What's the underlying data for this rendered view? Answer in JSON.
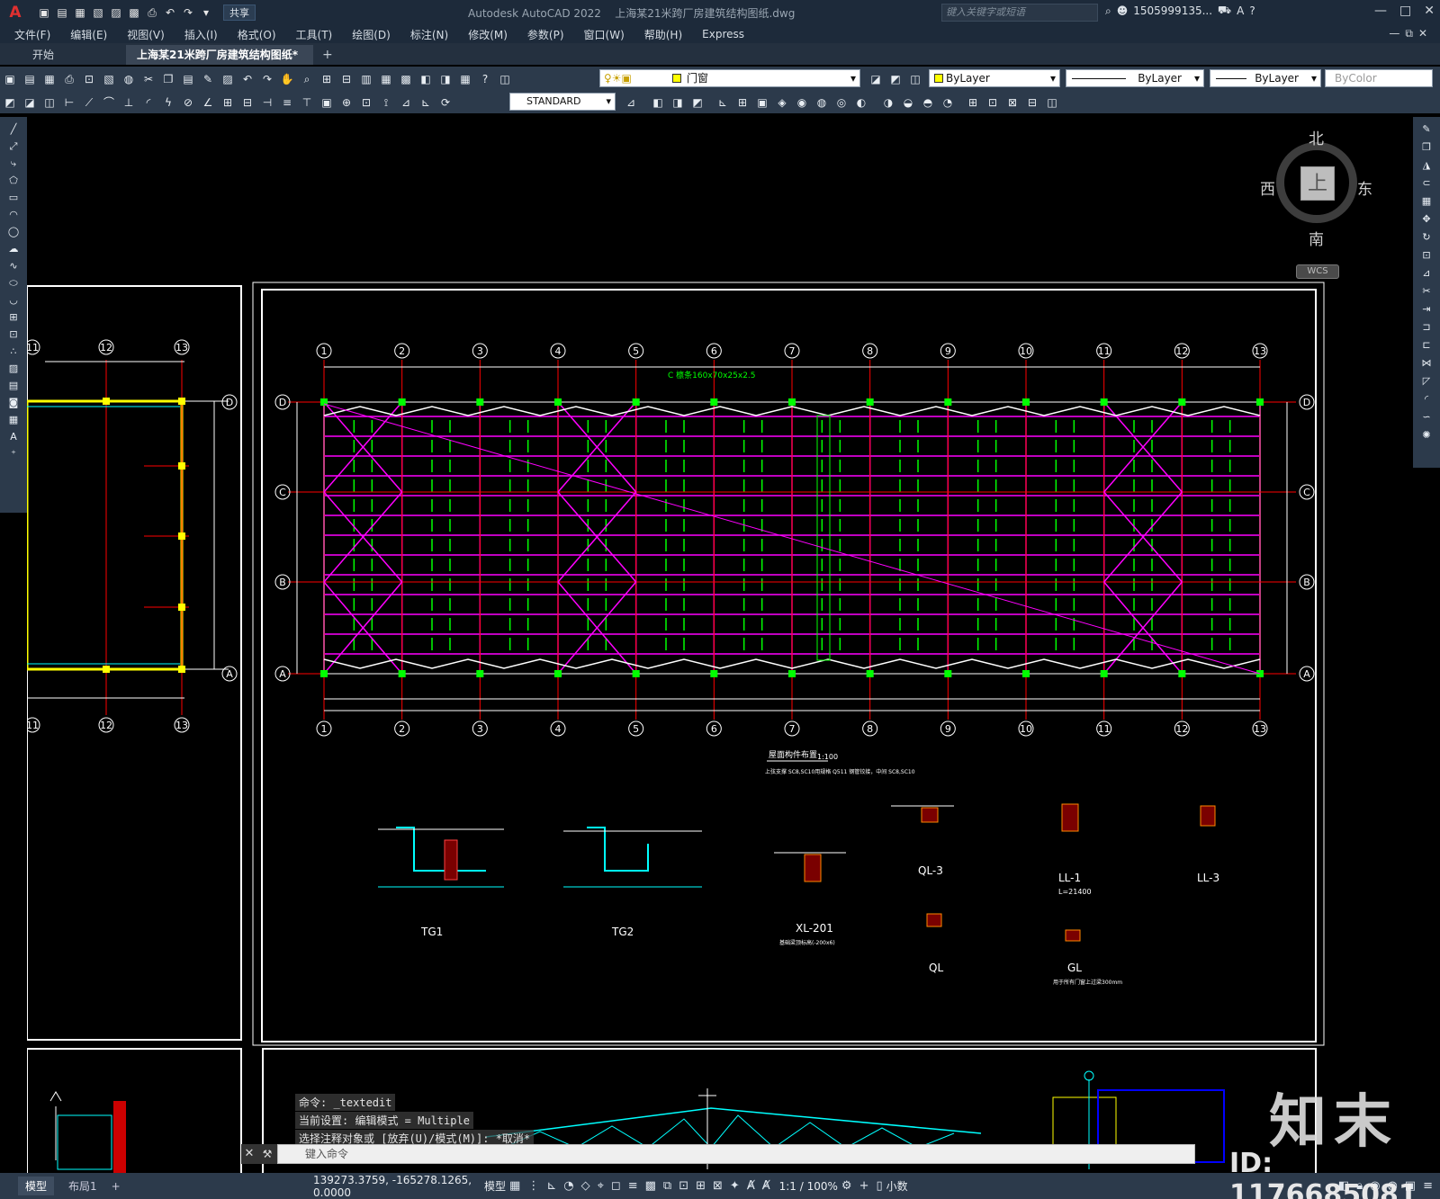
{
  "titlebar": {
    "logo": "A",
    "share": "共享",
    "app_name": "Autodesk AutoCAD 2022",
    "file_name": "上海某21米跨厂房建筑结构图纸.dwg",
    "search_placeholder": "键入关键字或短语",
    "user": "1505999135...",
    "minimize": "—",
    "maximize": "□",
    "close": "✕"
  },
  "menubar": {
    "items": [
      "文件(F)",
      "编辑(E)",
      "视图(V)",
      "插入(I)",
      "格式(O)",
      "工具(T)",
      "绘图(D)",
      "标注(N)",
      "修改(M)",
      "参数(P)",
      "窗口(W)",
      "帮助(H)",
      "Express"
    ]
  },
  "tabs": {
    "start": "开始",
    "active": "上海某21米跨厂房建筑结构图纸*",
    "add": "+"
  },
  "toolbar": {
    "layer_name": "门窗",
    "color": "ByLayer",
    "linetype": "ByLayer",
    "lineweight": "ByLayer",
    "plotstyle": "ByColor",
    "text_style": "STANDARD"
  },
  "viewcube": {
    "north": "北",
    "south": "南",
    "east": "东",
    "west": "西",
    "face": "上",
    "wcs": "WCS"
  },
  "drawing": {
    "axis_top": [
      "1",
      "2",
      "3",
      "4",
      "5",
      "6",
      "7",
      "8",
      "9",
      "10",
      "11",
      "12",
      "13"
    ],
    "axis_side": [
      "D",
      "C",
      "B",
      "A"
    ],
    "left_axis_top": [
      "11",
      "12",
      "13"
    ],
    "plan_title": "屋面构件布置",
    "plan_scale": "1:100",
    "plan_note": "上弦支撑 SC8,SC10用规格 Q511 钢管铰接，中间 SC8,SC10",
    "label_wall": "C 檩条160x70x25x2.5",
    "detail_labels": [
      "TG1",
      "TG2",
      "XL-201",
      "QL-3",
      "QL",
      "LL-1",
      "LL-3",
      "GL"
    ],
    "ll1_sub": "L=21400",
    "gl_sub": "用于所有门窗上过梁300mm",
    "xl_sub": "基础梁顶标高(-200x6)"
  },
  "command": {
    "line1": "命令: _textedit",
    "line2": "当前设置: 编辑模式 = Multiple",
    "line3": "选择注释对象或 [放弃(U)/模式(M)]: *取消*",
    "input_placeholder": "键入命令"
  },
  "layout_tabs": [
    "模型",
    "布局1",
    "+"
  ],
  "status": {
    "coords": "139273.3759, -165278.1265, 0.0000",
    "model": "模型",
    "scale": "1:1 / 100%",
    "units": "小数"
  },
  "watermark": {
    "logo": "知末",
    "id": "ID: 1176685081"
  }
}
